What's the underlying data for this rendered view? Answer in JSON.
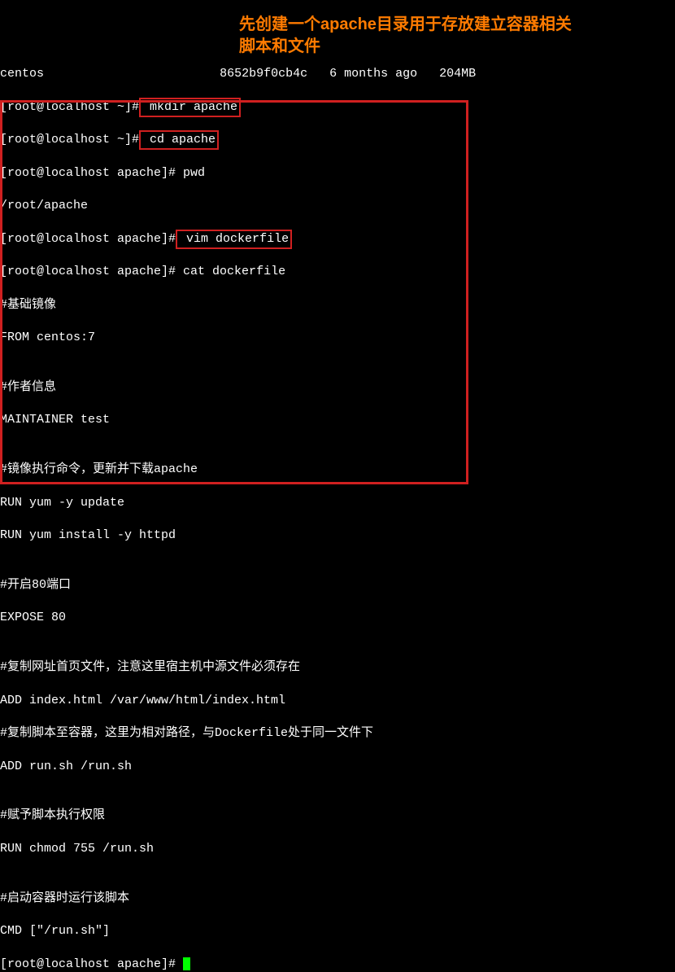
{
  "lines": {
    "top0a": "centos",
    "top0b": "8652b9f0cb4c",
    "top0c": "6 months ago",
    "top0d": "204MB",
    "prompt_home": "[root@localhost ~]#",
    "prompt_apache": "[root@localhost apache]#",
    "cmd_mkdir": " mkdir apache",
    "cmd_cd": " cd apache",
    "cmd_pwd": " pwd",
    "pwd_out": "/root/apache",
    "cmd_vim": " vim dockerfile",
    "cmd_cat": " cat dockerfile",
    "df1": "#基础镜像",
    "df2": "FROM centos:7",
    "df3": "",
    "df4": "#作者信息",
    "df5": "MAINTAINER test",
    "df6": "",
    "df7": "#镜像执行命令，更新并下载apache",
    "df8": "RUN yum -y update",
    "df9": "RUN yum install -y httpd",
    "df10": "",
    "df11": "#开启80端口",
    "df12": "EXPOSE 80",
    "df13": "",
    "df14": "#复制网址首页文件，注意这里宿主机中源文件必须存在",
    "df15": "ADD index.html /var/www/html/index.html",
    "df16": "#复制脚本至容器，这里为相对路径，与Dockerfile处于同一文件下",
    "df17": "ADD run.sh /run.sh",
    "df18": "",
    "df19": "#赋予脚本执行权限",
    "df20": "RUN chmod 755 /run.sh",
    "df21": "",
    "df22": "#启动容器时运行该脚本",
    "df23": "CMD [\"/run.sh\"]"
  },
  "annotation": {
    "l1": "先创建一个apache目录用于存放建立容器相关",
    "l2": "脚本和文件"
  },
  "chart_data": null
}
